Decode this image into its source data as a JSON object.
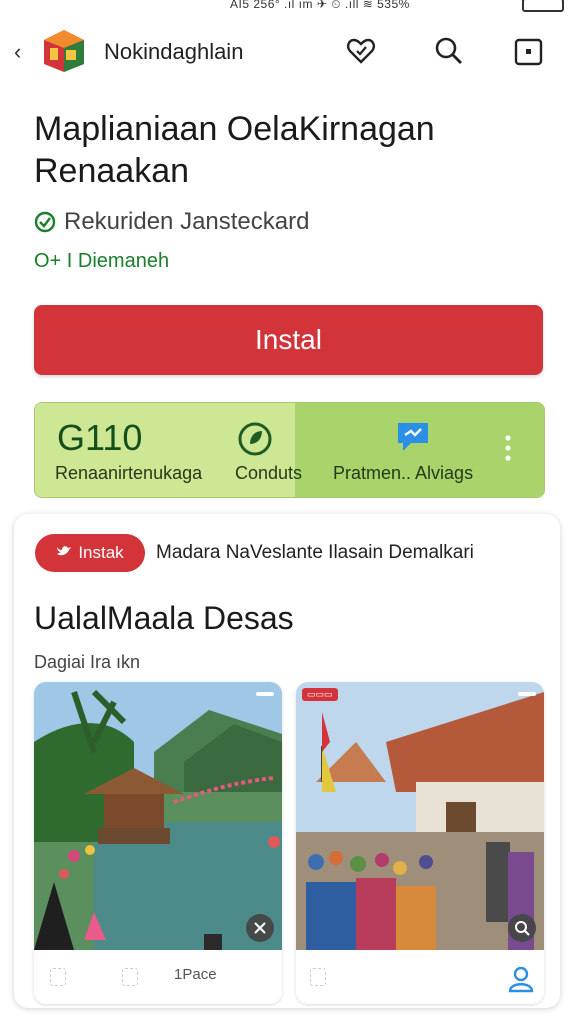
{
  "status_bar": {
    "text": "AI5 256° .ıl ım ✈ ⏲ .ıll ≋ 535%"
  },
  "header": {
    "app_name": "Nokindaghlain"
  },
  "app": {
    "title": "Maplianiaan OelaKirnagan Renaakan",
    "developer": "Rekuriden Jansteckard",
    "downloads": "O+ I Diemaneh",
    "install_label": "Instal"
  },
  "info": {
    "rating": "G110",
    "rating_label": "Renaanirtenukaga",
    "contacts_label": "Conduts",
    "permissions_label": "Pratmen.. Alviags"
  },
  "promo": {
    "pill_label": "Instak",
    "description": "Madara NaVeslante Ilasain Demalkari"
  },
  "gallery": {
    "section_title": "UalalMaala Desas",
    "subsection": "Dagiai Ira ıkn",
    "shot1_caption": "1Pace"
  },
  "colors": {
    "accent": "#d3343a",
    "rating_bg": "#cde794",
    "rating_bg_dark": "#a9d36b",
    "verified": "#1a7f2b"
  }
}
